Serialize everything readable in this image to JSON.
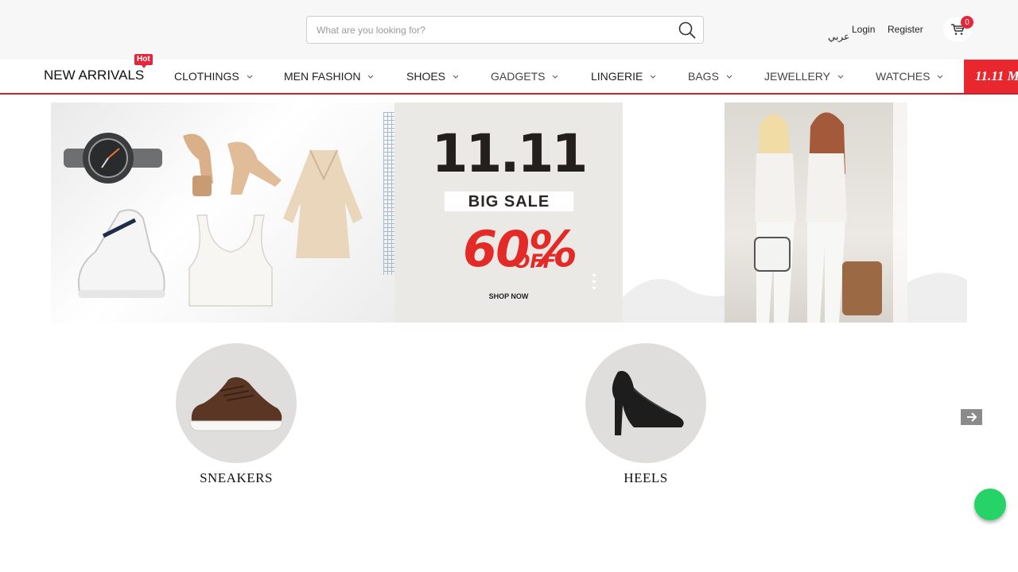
{
  "header": {
    "search": {
      "placeholder": "What are you looking for?",
      "value": ""
    },
    "language_label": "عربي",
    "login_label": "Login",
    "register_label": "Register",
    "cart_count": "0"
  },
  "nav": {
    "new_arrivals": "NEW ARRIVALS",
    "hot_badge": "Hot",
    "items": [
      {
        "label": "CLOTHINGS"
      },
      {
        "label": "MEN FASHION"
      },
      {
        "label": "SHOES"
      },
      {
        "label": "GADGETS"
      },
      {
        "label": "LINGERIE"
      },
      {
        "label": "BAGS"
      },
      {
        "label": "JEWELLERY"
      },
      {
        "label": "WATCHES"
      }
    ],
    "promo_tab": "11.11 M"
  },
  "banner": {
    "sale_title": "11.11",
    "sale_band": "BIG SALE",
    "sale_percent": "60%",
    "sale_off": "OFF",
    "sale_cta": "SHOP NOW"
  },
  "categories": [
    {
      "label": "SNEAKERS"
    },
    {
      "label": "HEELS"
    }
  ],
  "colors": {
    "accent_red": "#e5263a",
    "nav_underline": "#c8242a",
    "chat_green": "#25d366"
  }
}
